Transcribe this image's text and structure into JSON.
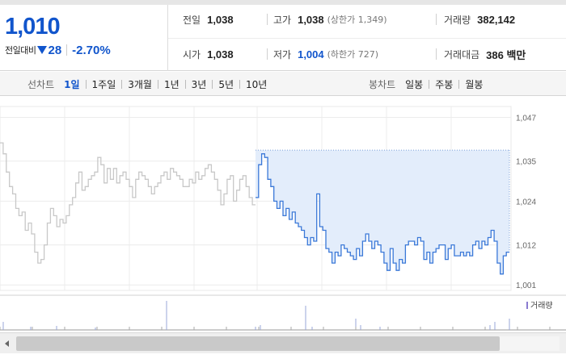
{
  "quote": {
    "price": "1,010",
    "change_label": "전일대비",
    "change_amount": "28",
    "change_rate": "-2.70%",
    "direction": "down",
    "colors": {
      "down": "#1155cc"
    }
  },
  "stats": {
    "prev_close": {
      "label": "전일",
      "value": "1,038"
    },
    "high": {
      "label": "고가",
      "value": "1,038",
      "sub": "(상한가 1,349)"
    },
    "volume": {
      "label": "거래량",
      "value": "382,142"
    },
    "open": {
      "label": "시가",
      "value": "1,038"
    },
    "low": {
      "label": "저가",
      "value": "1,004",
      "sub": "(하한가 727)"
    },
    "amount": {
      "label": "거래대금",
      "value": "386 백만"
    }
  },
  "line_chart_tabs": {
    "title": "선차트",
    "items": [
      "1일",
      "1주일",
      "3개월",
      "1년",
      "3년",
      "5년",
      "10년"
    ],
    "active": "1일"
  },
  "candle_chart_tabs": {
    "title": "봉차트",
    "items": [
      "일봉",
      "주봉",
      "월봉"
    ]
  },
  "chart_data": {
    "type": "line",
    "y_ticks": [
      "1,047",
      "1,035",
      "1,024",
      "1,012",
      "1,001"
    ],
    "ylim": [
      1001,
      1047
    ],
    "reference_line": 1038,
    "volume_label": "거래량",
    "series": [
      {
        "values": [
          1040,
          1037,
          1032,
          1028,
          1026,
          1022,
          1020,
          1021,
          1016,
          1018,
          1015,
          1010,
          1007,
          1008,
          1012,
          1018,
          1022,
          1020,
          1017,
          1019,
          1018,
          1020,
          1023,
          1025,
          1029,
          1032,
          1027,
          1028,
          1030,
          1031,
          1032,
          1036,
          1034,
          1029,
          1033,
          1030,
          1033,
          1029,
          1031,
          1032,
          1030,
          1028,
          1025,
          1030,
          1032,
          1031,
          1030,
          1028,
          1026,
          1028,
          1029,
          1031,
          1032,
          1030,
          1033,
          1032,
          1031,
          1030,
          1028,
          1028,
          1030,
          1029,
          1032,
          1030,
          1031,
          1033,
          1034,
          1032,
          1030,
          1027,
          1023,
          1026,
          1030,
          1031,
          1024,
          1027,
          1030,
          1031,
          1028,
          1025,
          1023,
          1023
        ],
        "color": "#c8c8c8"
      },
      {
        "values": [
          1025,
          1034,
          1037,
          1036,
          1030,
          1028,
          1024,
          1022,
          1024,
          1020,
          1022,
          1019,
          1021,
          1018,
          1017,
          1016,
          1014,
          1012,
          1014,
          1013,
          1026,
          1017,
          1016,
          1011,
          1010,
          1007,
          1010,
          1009,
          1012,
          1011,
          1010,
          1009,
          1008,
          1011,
          1009,
          1013,
          1015,
          1013,
          1011,
          1013,
          1012,
          1010,
          1007,
          1005,
          1011,
          1007,
          1005,
          1008,
          1007,
          1012,
          1013,
          1013,
          1012,
          1014,
          1013,
          1008,
          1010,
          1007,
          1010,
          1011,
          1012,
          1012,
          1008,
          1011,
          1012,
          1009,
          1009,
          1010,
          1009,
          1010,
          1009,
          1012,
          1013,
          1011,
          1013,
          1012,
          1014,
          1016,
          1013,
          1007,
          1004,
          1009,
          1010,
          1010
        ],
        "color": "#3a78d8"
      }
    ],
    "grid": true
  }
}
